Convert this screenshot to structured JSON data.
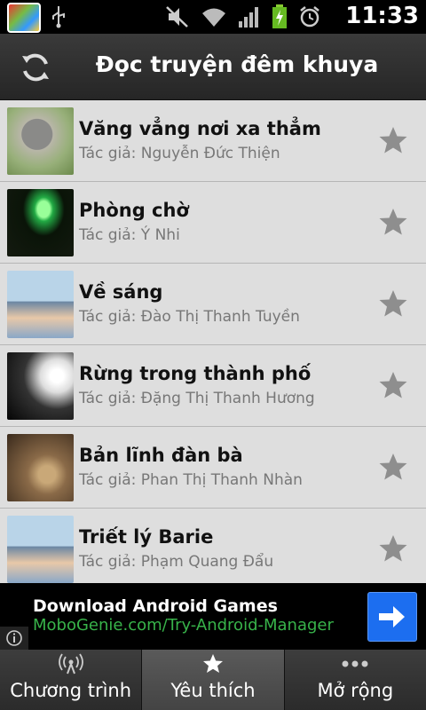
{
  "status_bar": {
    "time": "11:33"
  },
  "header": {
    "title": "Đọc truyện đêm khuya"
  },
  "stories": [
    {
      "title": "Văng vẳng nơi xa thẳm",
      "author": "Tác giả: Nguyễn Đức Thiện",
      "thumb": "cat-photo"
    },
    {
      "title": "Phòng chờ",
      "author": "Tác giả: Ý Nhi",
      "thumb": "couple-heart"
    },
    {
      "title": "Về sáng",
      "author": "Tác giả: Đào Thị Thanh Tuyền",
      "thumb": "anime-girl-window"
    },
    {
      "title": "Rừng trong thành phố",
      "author": "Tác giả: Đặng Thị Thanh Hương",
      "thumb": "silhouette-dark"
    },
    {
      "title": "Bản lĩnh đàn bà",
      "author": "Tác giả: Phan Thị Thanh Nhàn",
      "thumb": "danbo-lights"
    },
    {
      "title": "Triết lý Barie",
      "author": "Tác giả: Phạm Quang Đẩu",
      "thumb": "anime-girl-window"
    }
  ],
  "ad": {
    "headline": "Download Android Games",
    "url": "MoboGenie.com/Try-Android-Manager"
  },
  "tabs": [
    {
      "label": "Chương trình",
      "icon": "broadcast-icon"
    },
    {
      "label": "Yêu thích",
      "icon": "star-icon"
    },
    {
      "label": "Mở rộng",
      "icon": "more-dots-icon"
    }
  ],
  "colors": {
    "ad_button": "#1c6ef0",
    "ad_url": "#38b34a",
    "header_bg": "#2e2e2e"
  }
}
